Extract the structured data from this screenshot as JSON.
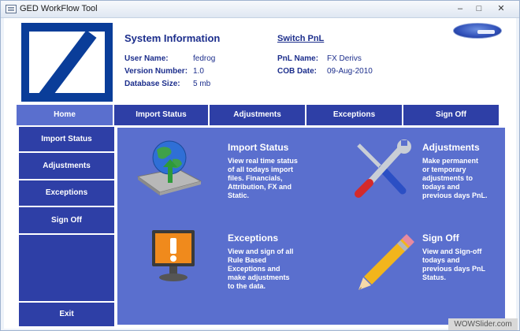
{
  "window": {
    "title": "GED WorkFlow Tool",
    "controls": {
      "minimize": "–",
      "maximize": "□",
      "close": "✕"
    }
  },
  "header": {
    "section_title": "System Information",
    "switch_link": "Switch PnL",
    "fields": {
      "user_name_label": "User Name:",
      "user_name_value": "fedrog",
      "version_label": "Version Number:",
      "version_value": "1.0",
      "db_size_label": "Database Size:",
      "db_size_value": "5 mb",
      "pnl_name_label": "PnL Name:",
      "pnl_name_value": "FX Derivs",
      "cob_date_label": "COB Date:",
      "cob_date_value": "09-Aug-2010"
    }
  },
  "topnav": {
    "tabs": [
      "Home",
      "Import Status",
      "Adjustments",
      "Exceptions",
      "Sign Off"
    ],
    "active": "Home"
  },
  "sidebar": {
    "items": [
      "Import Status",
      "Adjustments",
      "Exceptions",
      "Sign Off"
    ],
    "exit": "Exit"
  },
  "features": {
    "import_status": {
      "title": "Import Status",
      "desc_lines": [
        "View real time status",
        "of all todays import",
        "files. Financials,",
        "Attribution, FX and",
        "Static."
      ],
      "icon": "globe-icon"
    },
    "adjustments": {
      "title": "Adjustments",
      "desc_lines": [
        "Make permanent",
        "or temporary",
        "adjustments to",
        "todays and",
        "previous days PnL."
      ],
      "icon": "tools-icon"
    },
    "exceptions": {
      "title": "Exceptions",
      "desc_lines": [
        "View and sign of all",
        "Rule Based",
        "Exceptions and",
        "make adjustments",
        "to the data."
      ],
      "icon": "warning-monitor-icon"
    },
    "sign_off": {
      "title": "Sign Off",
      "desc_lines": [
        "View and Sign-off",
        "todays and",
        "previous days PnL",
        "Status."
      ],
      "icon": "pencil-icon"
    }
  },
  "watermark": "WOWSlider.com",
  "colors": {
    "nav_blue": "#2e3fa6",
    "panel_blue": "#5a6fce",
    "header_text": "#1c2e8c",
    "logo_blue": "#0a3d99"
  }
}
